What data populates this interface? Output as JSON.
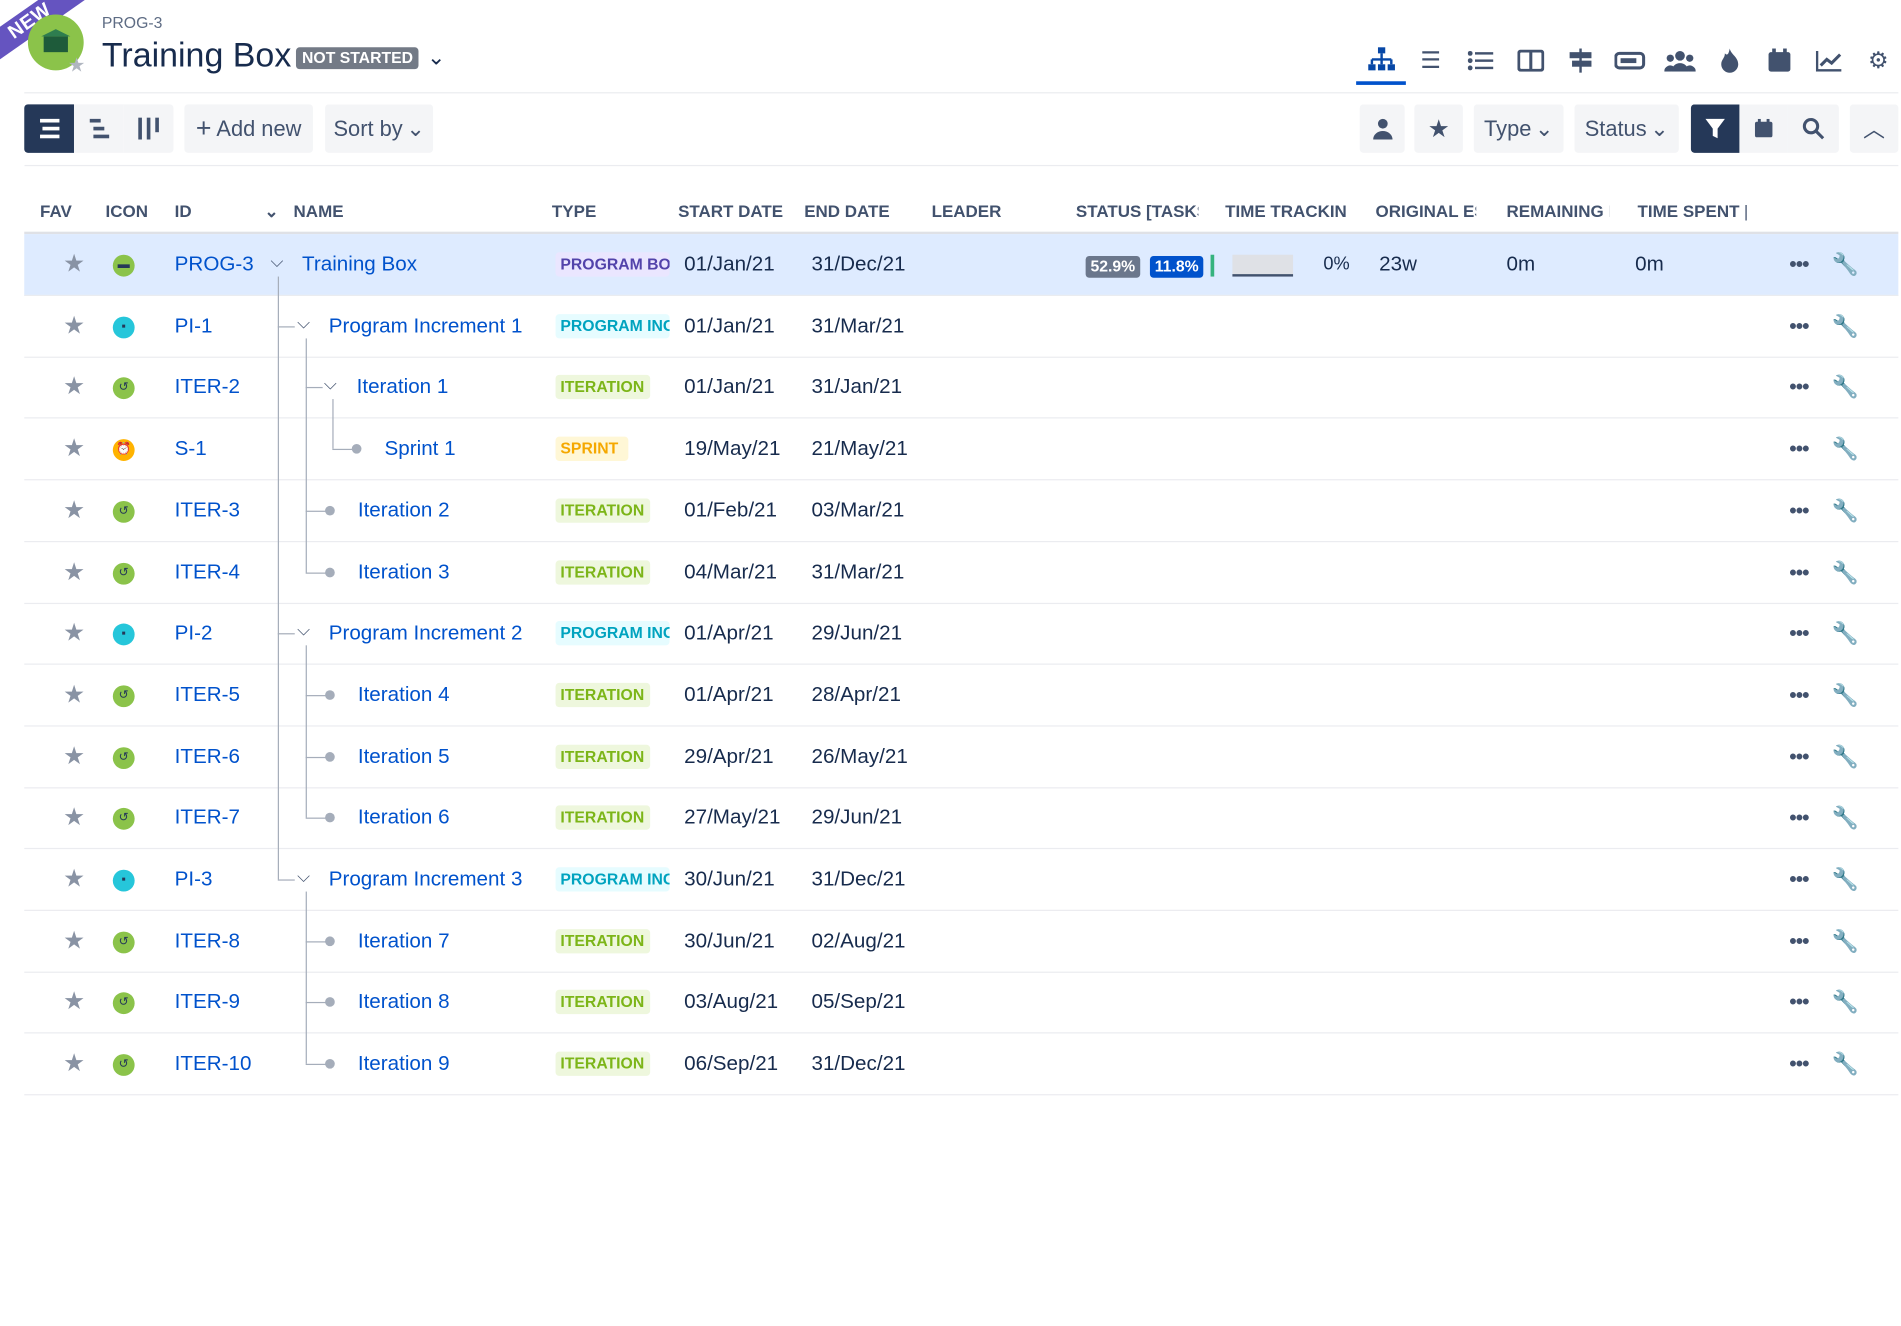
{
  "header": {
    "ribbon": "NEW",
    "project_id": "PROG-3",
    "title": "Training Box",
    "status": "NOT STARTED",
    "view_tabs": [
      {
        "icon": "hierarchy-icon",
        "active": true
      },
      {
        "icon": "list-icon",
        "active": false
      },
      {
        "icon": "bullet-list-icon",
        "active": false
      },
      {
        "icon": "board-icon",
        "active": false
      },
      {
        "icon": "roadmap-icon",
        "active": false
      },
      {
        "icon": "progress-icon",
        "active": false
      },
      {
        "icon": "team-icon",
        "active": false
      },
      {
        "icon": "fire-icon",
        "active": false
      },
      {
        "icon": "calendar-icon",
        "active": false
      },
      {
        "icon": "chart-icon",
        "active": false
      },
      {
        "icon": "settings-icon",
        "active": false
      }
    ]
  },
  "toolbar": {
    "add_new": "Add new",
    "sort_by": "Sort by",
    "type_filter": "Type",
    "status_filter": "Status"
  },
  "columns": {
    "fav": "FAV",
    "icon": "ICON",
    "id": "ID",
    "name": "NAME",
    "type": "TYPE",
    "start_date": "START DATE",
    "end_date": "END DATE",
    "leader": "LEADER",
    "status": "STATUS [TASKS",
    "time_tracking": "TIME TRACKING",
    "original_est": "ORIGINAL ES",
    "remaining": "REMAINING E",
    "time_spent": "TIME SPENT |"
  },
  "rows": [
    {
      "id": "PROG-3",
      "name": "Training Box",
      "type": "PROGRAM BOX",
      "start": "01/Jan/21",
      "end": "31/Dec/21",
      "kind": "prog",
      "status_done": "52.9%",
      "status_progress": "11.8%",
      "time_tracking": "0%",
      "original_est": "23w",
      "remaining": "0m",
      "time_spent": "0m"
    },
    {
      "id": "PI-1",
      "name": "Program Increment 1",
      "type": "PROGRAM INCREMENT",
      "start": "01/Jan/21",
      "end": "31/Mar/21",
      "kind": "pi"
    },
    {
      "id": "ITER-2",
      "name": "Iteration 1",
      "type": "ITERATION",
      "start": "01/Jan/21",
      "end": "31/Jan/21",
      "kind": "iter"
    },
    {
      "id": "S-1",
      "name": "Sprint 1",
      "type": "SPRINT",
      "start": "19/May/21",
      "end": "21/May/21",
      "kind": "sprint"
    },
    {
      "id": "ITER-3",
      "name": "Iteration 2",
      "type": "ITERATION",
      "start": "01/Feb/21",
      "end": "03/Mar/21",
      "kind": "iter"
    },
    {
      "id": "ITER-4",
      "name": "Iteration 3",
      "type": "ITERATION",
      "start": "04/Mar/21",
      "end": "31/Mar/21",
      "kind": "iter"
    },
    {
      "id": "PI-2",
      "name": "Program Increment 2",
      "type": "PROGRAM INCREMENT",
      "start": "01/Apr/21",
      "end": "29/Jun/21",
      "kind": "pi"
    },
    {
      "id": "ITER-5",
      "name": "Iteration 4",
      "type": "ITERATION",
      "start": "01/Apr/21",
      "end": "28/Apr/21",
      "kind": "iter"
    },
    {
      "id": "ITER-6",
      "name": "Iteration 5",
      "type": "ITERATION",
      "start": "29/Apr/21",
      "end": "26/May/21",
      "kind": "iter"
    },
    {
      "id": "ITER-7",
      "name": "Iteration 6",
      "type": "ITERATION",
      "start": "27/May/21",
      "end": "29/Jun/21",
      "kind": "iter"
    },
    {
      "id": "PI-3",
      "name": "Program Increment 3",
      "type": "PROGRAM INCREMENT",
      "start": "30/Jun/21",
      "end": "31/Dec/21",
      "kind": "pi"
    },
    {
      "id": "ITER-8",
      "name": "Iteration 7",
      "type": "ITERATION",
      "start": "30/Jun/21",
      "end": "02/Aug/21",
      "kind": "iter"
    },
    {
      "id": "ITER-9",
      "name": "Iteration 8",
      "type": "ITERATION",
      "start": "03/Aug/21",
      "end": "05/Sep/21",
      "kind": "iter"
    },
    {
      "id": "ITER-10",
      "name": "Iteration 9",
      "type": "ITERATION",
      "start": "06/Sep/21",
      "end": "31/Dec/21",
      "kind": "iter"
    }
  ],
  "colors": {
    "accent": "#0052cc",
    "program_box_text": "#5243aa",
    "program_box_bg": "#eae6ff",
    "increment_text": "#00a3bf",
    "increment_bg": "#e6fcff",
    "iteration_text": "#7cb518",
    "iteration_bg": "#eef7dd",
    "sprint_text": "#f5a800",
    "sprint_bg": "#fff7d6"
  }
}
